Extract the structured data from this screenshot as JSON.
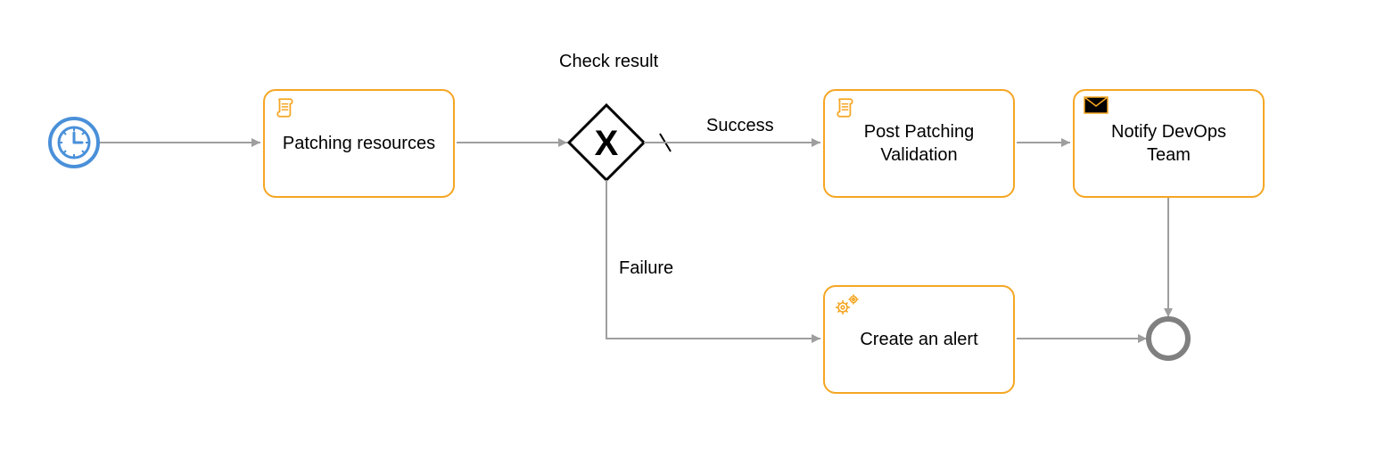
{
  "gateway": {
    "label": "Check result"
  },
  "edges": {
    "success": "Success",
    "failure": "Failure"
  },
  "tasks": {
    "patching": "Patching resources",
    "post_validation": "Post Patching Validation",
    "create_alert": "Create an alert",
    "notify": "Notify DevOps Team"
  },
  "colors": {
    "task_border": "#f5a623",
    "timer_stroke": "#4a90d9",
    "arrow": "#9e9e9e",
    "end_ring": "#808080",
    "gateway_stroke": "#000000",
    "mail_fill": "#000000"
  }
}
